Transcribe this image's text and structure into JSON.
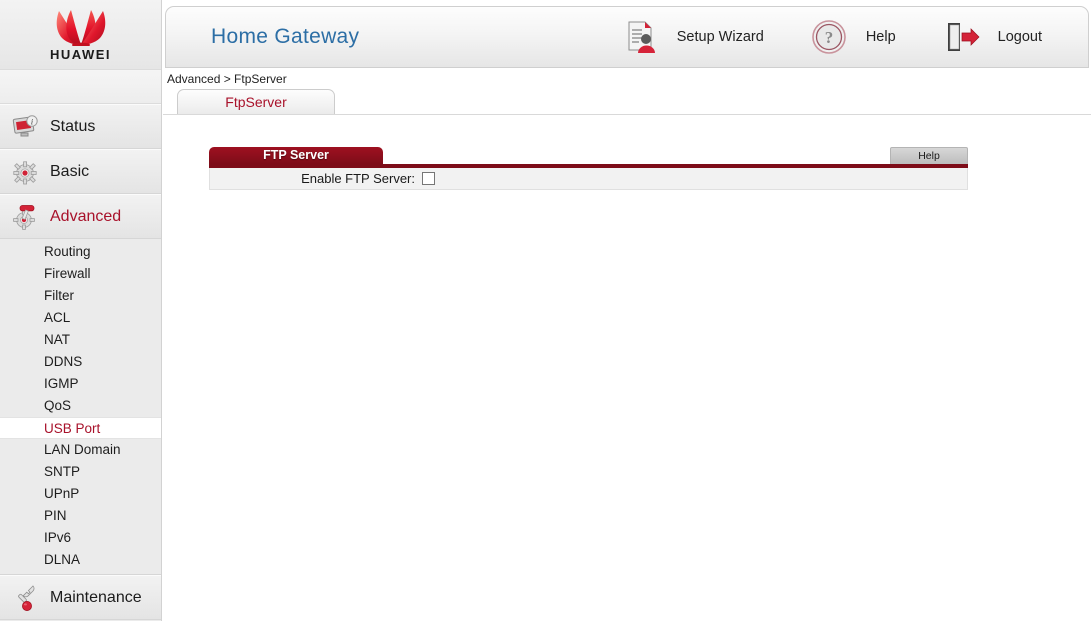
{
  "sidebar": {
    "logo": {
      "brand": "HUAWEI",
      "icon": "huawei-flower-logo"
    },
    "sections": [
      {
        "label": "Status",
        "icon": "monitor-info-icon",
        "active": false
      },
      {
        "label": "Basic",
        "icon": "gear-icon",
        "active": false
      },
      {
        "label": "Advanced",
        "icon": "gear-tool-icon",
        "active": true
      }
    ],
    "advanced_items": [
      {
        "label": "Routing",
        "active": false
      },
      {
        "label": "Firewall",
        "active": false
      },
      {
        "label": "Filter",
        "active": false
      },
      {
        "label": "ACL",
        "active": false
      },
      {
        "label": "NAT",
        "active": false
      },
      {
        "label": "DDNS",
        "active": false
      },
      {
        "label": "IGMP",
        "active": false
      },
      {
        "label": "QoS",
        "active": false
      },
      {
        "label": "USB Port",
        "active": true
      },
      {
        "label": "LAN Domain",
        "active": false
      },
      {
        "label": "SNTP",
        "active": false
      },
      {
        "label": "UPnP",
        "active": false
      },
      {
        "label": "PIN",
        "active": false
      },
      {
        "label": "IPv6",
        "active": false
      },
      {
        "label": "DLNA",
        "active": false
      }
    ],
    "maintenance": {
      "label": "Maintenance",
      "icon": "wrench-icon"
    }
  },
  "header": {
    "title": "Home Gateway",
    "actions": [
      {
        "label": "Setup Wizard",
        "icon": "document-user-icon"
      },
      {
        "label": "Help",
        "icon": "question-circle-icon"
      },
      {
        "label": "Logout",
        "icon": "door-exit-arrow-icon"
      }
    ]
  },
  "breadcrumb": "Advanced > FtpServer",
  "tabs": [
    {
      "label": "FtpServer",
      "active": true
    }
  ],
  "panel": {
    "title": "FTP Server",
    "help_label": "Help",
    "field_label": "Enable FTP Server:",
    "checkbox_checked": false
  },
  "colors": {
    "brand_red": "#a8112a",
    "panel_red": "#7d0c18",
    "title_blue": "#2c6ea5",
    "sidebar_bg": "#ebebeb",
    "panel_body_bg": "#f2f2f2"
  }
}
